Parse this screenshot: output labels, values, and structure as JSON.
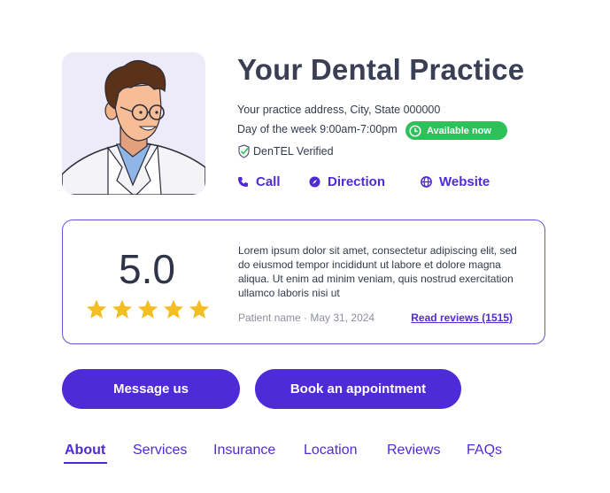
{
  "practice": {
    "name": "Your Dental Practice",
    "address": "Your practice address, City, State 000000",
    "hours": "Day of the week 9:00am-7:00pm",
    "availability": "Available now",
    "verified": "DenTEL Verified"
  },
  "actions": {
    "call": "Call",
    "direction": "Direction",
    "website": "Website"
  },
  "review": {
    "score": "5.0",
    "stars": 5,
    "text": "Lorem ipsum dolor sit amet, consectetur adipiscing elit, sed do eiusmod tempor incididunt ut labore et dolore magna aliqua. Ut enim ad minim veniam, quis nostrud exercitation ullamco laboris nisi ut",
    "meta": "Patient name · May 31, 2024",
    "read_link": "Read reviews (1515)"
  },
  "buttons": {
    "message": "Message us",
    "appointment": "Book an appointment"
  },
  "tabs": [
    "About",
    "Services",
    "Insurance",
    "Location",
    "Reviews",
    "FAQs"
  ],
  "colors": {
    "accent": "#4f2bd8",
    "available": "#2fc05a",
    "star": "#f2be22"
  }
}
